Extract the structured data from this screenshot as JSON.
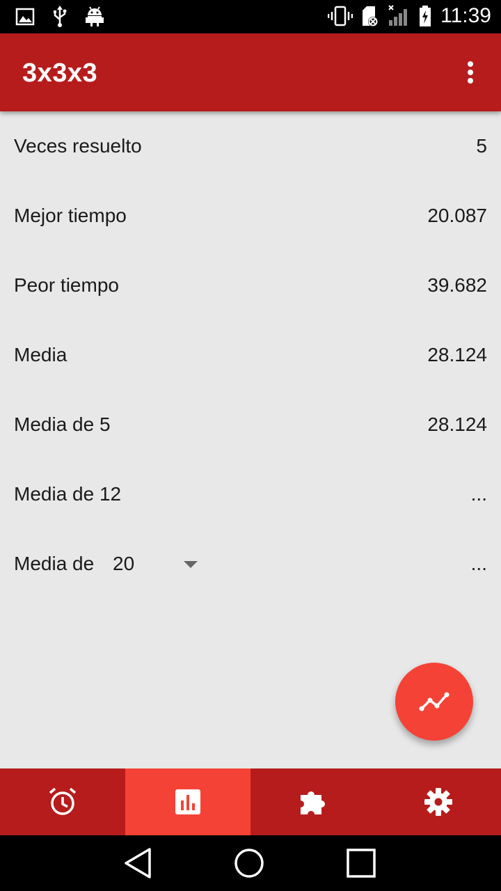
{
  "status_bar": {
    "time": "11:39",
    "icons": [
      "image-icon",
      "usb-icon",
      "android-debug-icon",
      "vibrate-icon",
      "sd-card-icon",
      "signal-icon",
      "battery-charging-icon"
    ]
  },
  "toolbar": {
    "title": "3x3x3",
    "menu_icon": "more-vert-icon"
  },
  "stats": [
    {
      "label": "Veces resuelto",
      "value": "5"
    },
    {
      "label": "Mejor tiempo",
      "value": "20.087"
    },
    {
      "label": "Peor tiempo",
      "value": "39.682"
    },
    {
      "label": "Media",
      "value": "28.124"
    },
    {
      "label": "Media de 5",
      "value": "28.124"
    },
    {
      "label": "Media de 12",
      "value": "..."
    }
  ],
  "average_n": {
    "label": "Media de",
    "selected": "20",
    "value": "..."
  },
  "fab": {
    "icon": "chart-line-icon"
  },
  "bottom_nav": [
    {
      "name": "timer",
      "icon": "alarm-icon",
      "active": false
    },
    {
      "name": "stats",
      "icon": "bar-chart-icon",
      "active": true
    },
    {
      "name": "puzzles",
      "icon": "puzzle-icon",
      "active": false
    },
    {
      "name": "settings",
      "icon": "gear-icon",
      "active": false
    }
  ],
  "colors": {
    "primary": "#b71c1c",
    "accent": "#f44336",
    "background": "#e8e8e8"
  }
}
